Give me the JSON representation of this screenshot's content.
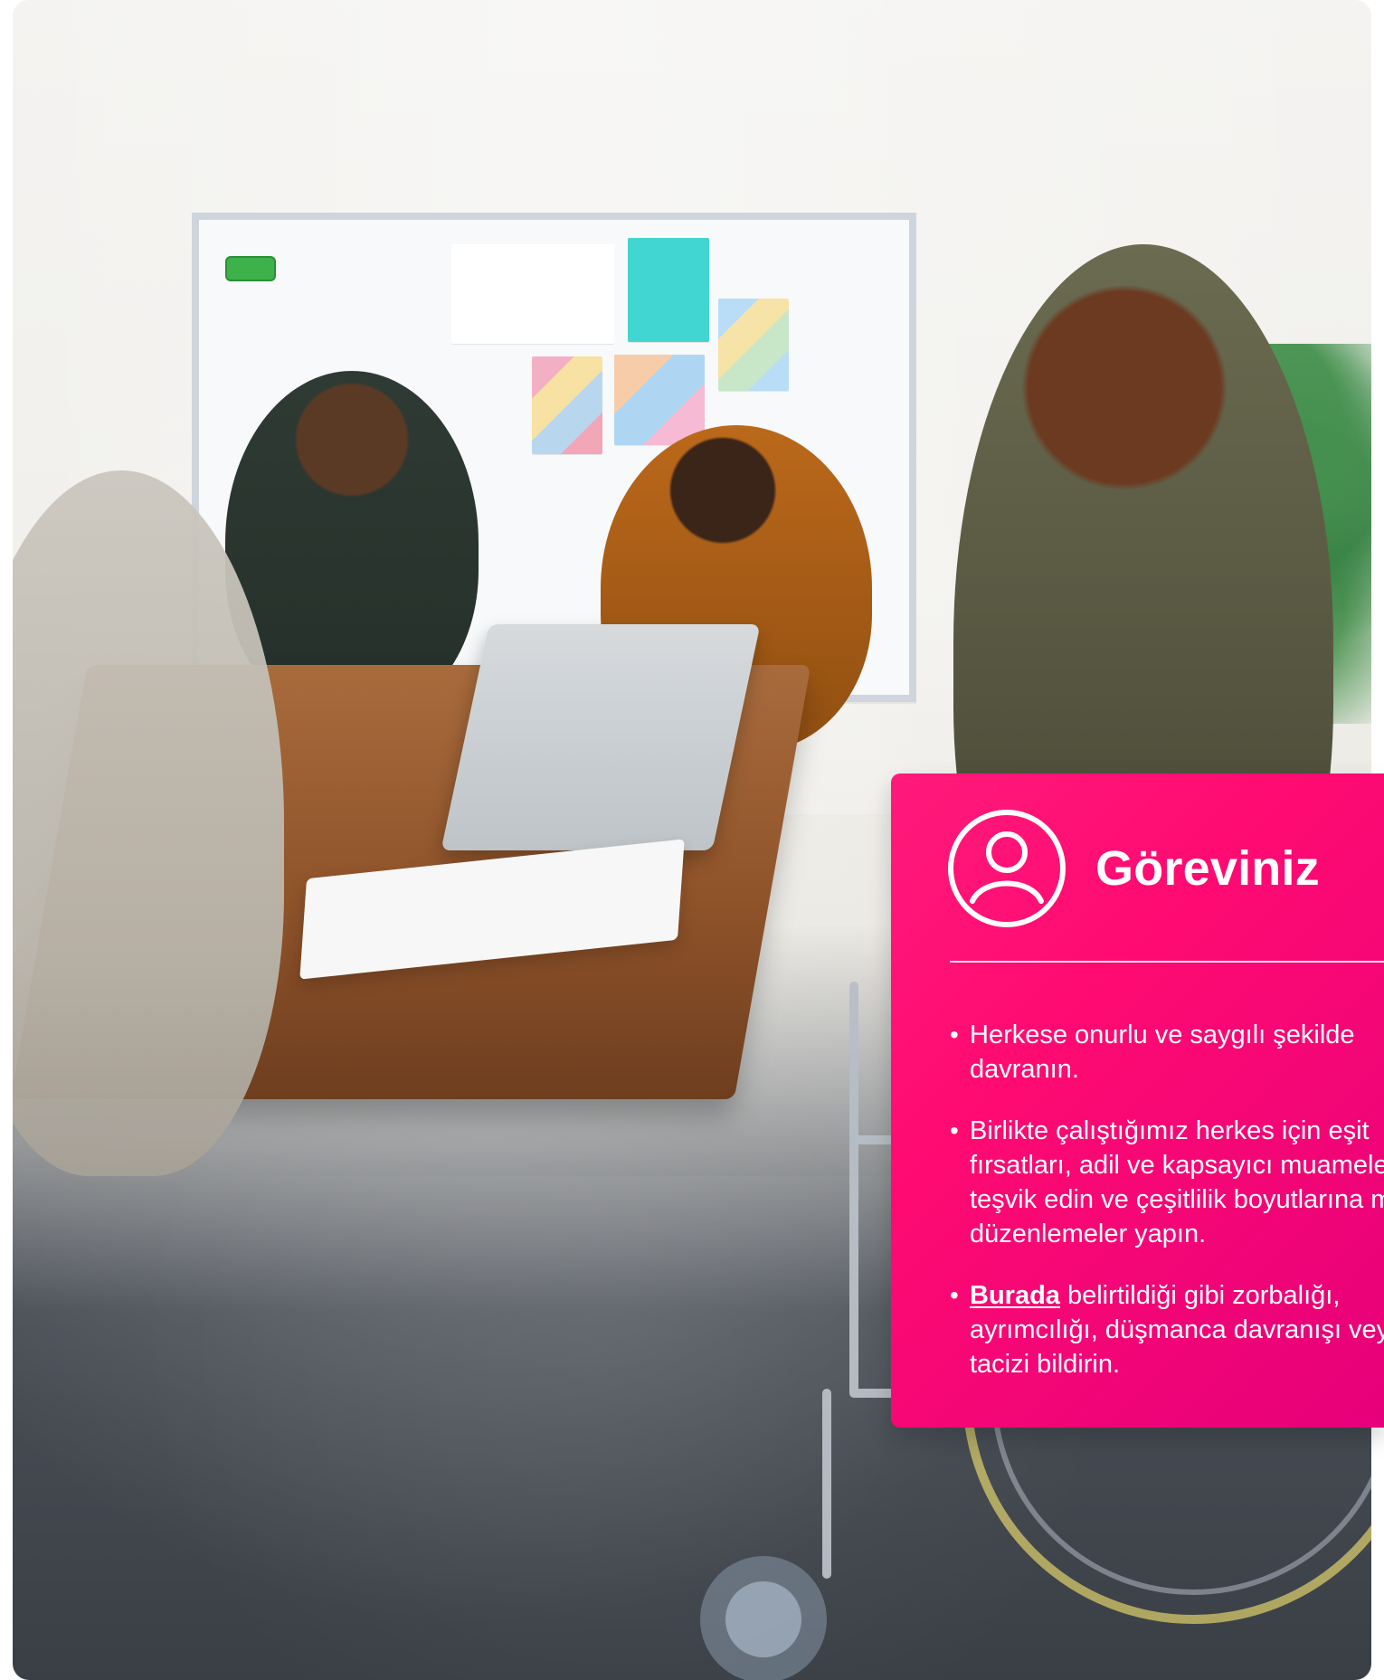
{
  "card": {
    "title": "Göreviniz",
    "icon": "user-outline-icon",
    "items": [
      {
        "text": "Herkese onurlu ve saygılı şekilde davranın."
      },
      {
        "text": "Birlikte çalıştığımız herkes için eşit fırsatları, adil ve kapsayıcı muameleyi teşvik edin ve çeşitlilik boyutlarına makul düzenlemeler yapın."
      },
      {
        "link": "Burada",
        "text": " belirtildiği gibi zorbalığı, ayrımcılığı, düşmanca davranışı veya tacizi bildirin."
      }
    ]
  },
  "colors": {
    "card_gradient_start": "#ff1a7a",
    "card_gradient_end": "#e6007a",
    "text": "#ffffff"
  }
}
